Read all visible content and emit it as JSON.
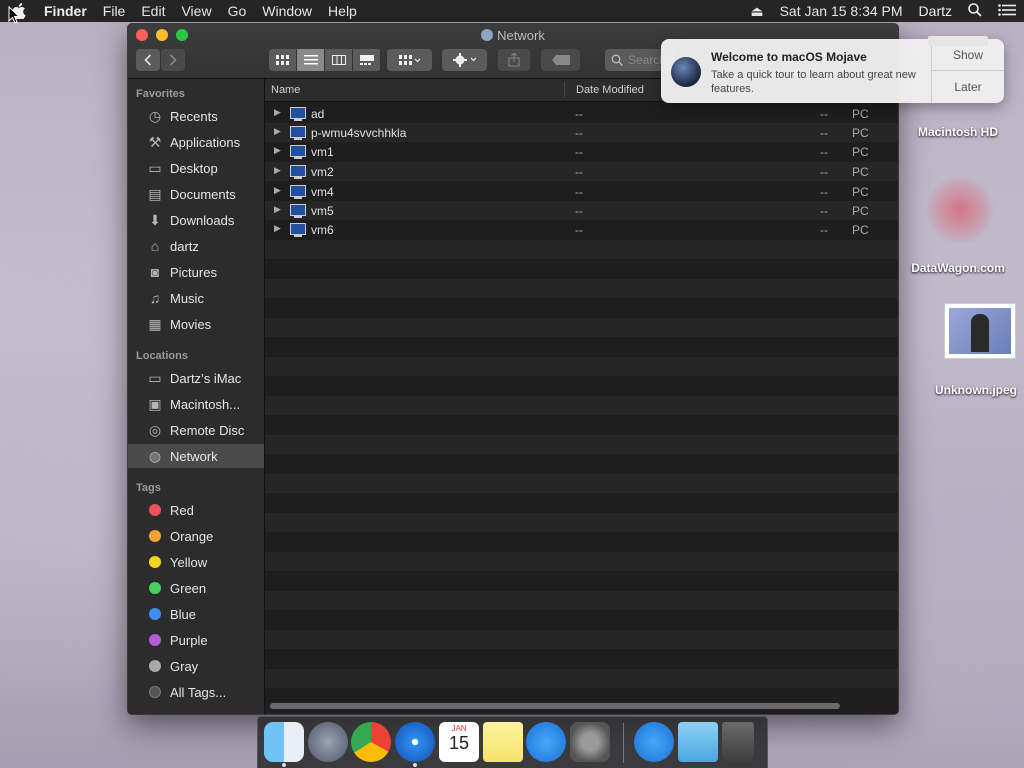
{
  "menubar": {
    "app": "Finder",
    "menus": [
      "File",
      "Edit",
      "View",
      "Go",
      "Window",
      "Help"
    ],
    "datetime": "Sat Jan 15  8:34 PM",
    "user": "Dartz"
  },
  "window": {
    "title": "Network",
    "search_placeholder": "Search"
  },
  "sidebar": {
    "favorites_header": "Favorites",
    "favorites": [
      {
        "label": "Recents",
        "icon": "clock-icon"
      },
      {
        "label": "Applications",
        "icon": "applications-icon"
      },
      {
        "label": "Desktop",
        "icon": "desktop-icon"
      },
      {
        "label": "Documents",
        "icon": "document-icon"
      },
      {
        "label": "Downloads",
        "icon": "download-icon"
      },
      {
        "label": "dartz",
        "icon": "home-icon"
      },
      {
        "label": "Pictures",
        "icon": "camera-icon"
      },
      {
        "label": "Music",
        "icon": "music-icon"
      },
      {
        "label": "Movies",
        "icon": "film-icon"
      }
    ],
    "locations_header": "Locations",
    "locations": [
      {
        "label": "Dartz’s iMac",
        "icon": "imac-icon"
      },
      {
        "label": "Macintosh...",
        "icon": "disk-icon"
      },
      {
        "label": "Remote Disc",
        "icon": "disc-icon"
      },
      {
        "label": "Network",
        "icon": "network-icon"
      }
    ],
    "tags_header": "Tags",
    "tags": [
      {
        "label": "Red",
        "color": "#f0525a"
      },
      {
        "label": "Orange",
        "color": "#f5a030"
      },
      {
        "label": "Yellow",
        "color": "#f4d51d"
      },
      {
        "label": "Green",
        "color": "#47d15f"
      },
      {
        "label": "Blue",
        "color": "#3f8ef5"
      },
      {
        "label": "Purple",
        "color": "#b25cdc"
      },
      {
        "label": "Gray",
        "color": "#a8a8a8"
      },
      {
        "label": "All Tags...",
        "color": "#555555"
      }
    ]
  },
  "list": {
    "columns": {
      "name": "Name",
      "date": "Date Modified"
    },
    "rows": [
      {
        "name": "ad",
        "date": "--",
        "size": "--",
        "kind": "PC"
      },
      {
        "name": "p-wmu4svvchhkla",
        "date": "--",
        "size": "--",
        "kind": "PC"
      },
      {
        "name": "vm1",
        "date": "--",
        "size": "--",
        "kind": "PC"
      },
      {
        "name": "vm2",
        "date": "--",
        "size": "--",
        "kind": "PC"
      },
      {
        "name": "vm4",
        "date": "--",
        "size": "--",
        "kind": "PC"
      },
      {
        "name": "vm5",
        "date": "--",
        "size": "--",
        "kind": "PC"
      },
      {
        "name": "vm6",
        "date": "--",
        "size": "--",
        "kind": "PC"
      }
    ]
  },
  "notification": {
    "title": "Welcome to macOS Mojave",
    "body": "Take a quick tour to learn about great new features.",
    "show": "Show",
    "later": "Later"
  },
  "desktop": {
    "icons": [
      "Macintosh HD",
      "DataWagon.com",
      "Unknown.jpeg"
    ]
  },
  "dock": {
    "calendar_month": "JAN",
    "calendar_day": "15"
  }
}
